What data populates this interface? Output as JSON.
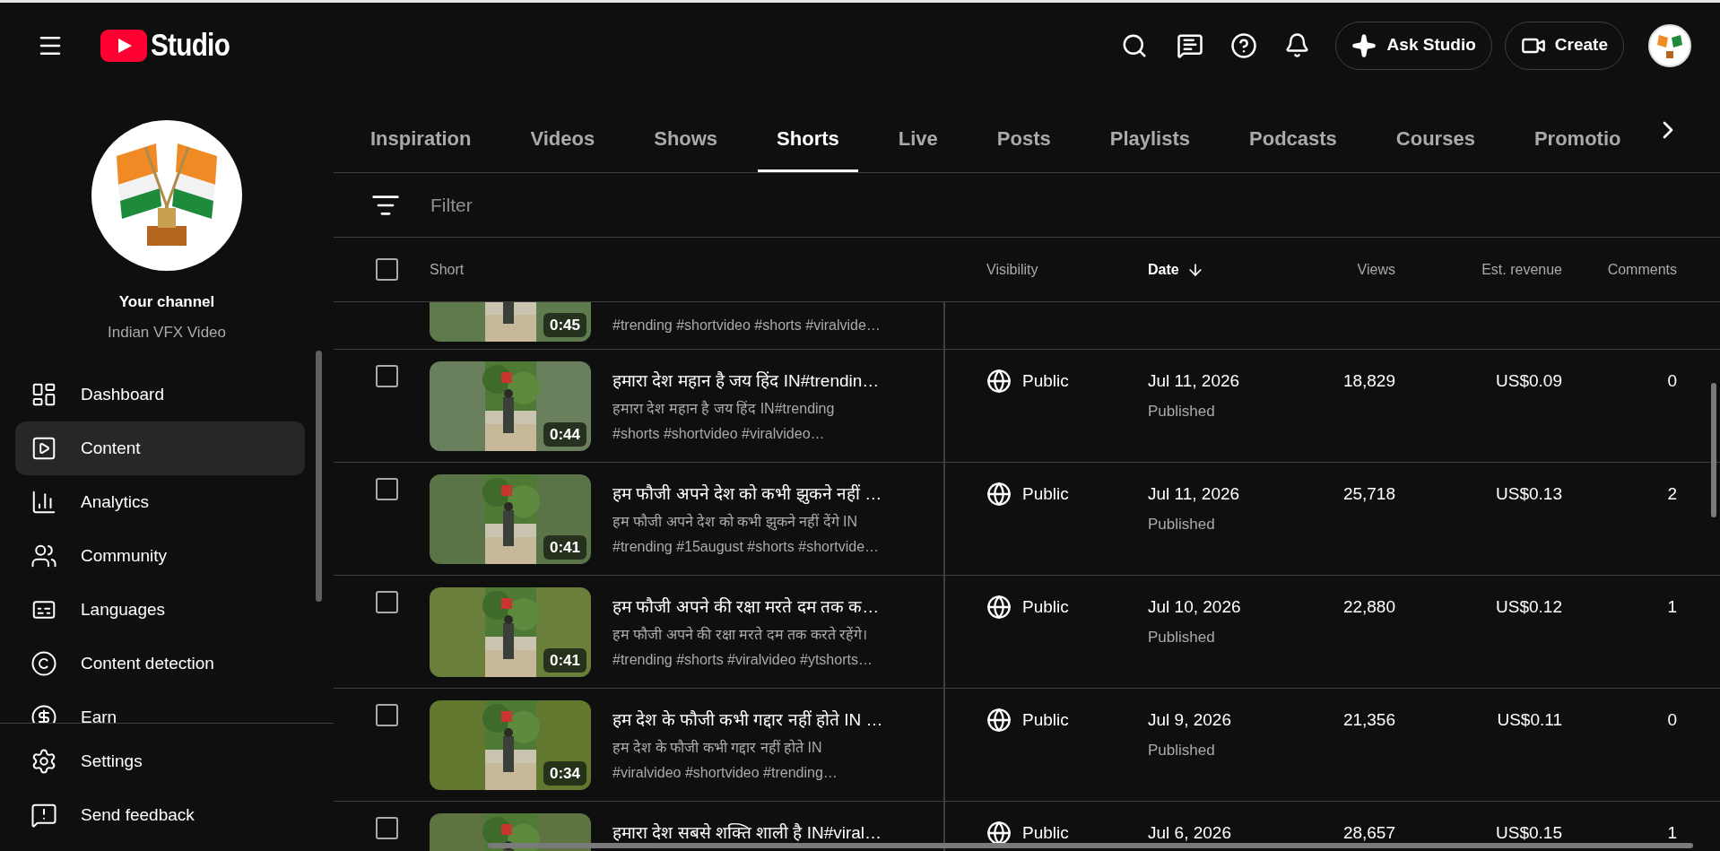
{
  "header": {
    "logo_text": "Studio",
    "ask_button": "Ask Studio",
    "create_button": "Create"
  },
  "sidebar": {
    "channel_label": "Your channel",
    "channel_name": "Indian VFX Video",
    "items": [
      {
        "kind": "dashboard",
        "label": "Dashboard",
        "selected": false
      },
      {
        "kind": "content",
        "label": "Content",
        "selected": true
      },
      {
        "kind": "analytics",
        "label": "Analytics",
        "selected": false
      },
      {
        "kind": "community",
        "label": "Community",
        "selected": false
      },
      {
        "kind": "languages",
        "label": "Languages",
        "selected": false
      },
      {
        "kind": "detection",
        "label": "Content detection",
        "selected": false
      },
      {
        "kind": "earn",
        "label": "Earn",
        "selected": false
      }
    ],
    "footer_items": [
      {
        "kind": "settings",
        "label": "Settings"
      },
      {
        "kind": "feedback",
        "label": "Send feedback"
      }
    ]
  },
  "tabs": [
    {
      "label": "Inspiration",
      "selected": false
    },
    {
      "label": "Videos",
      "selected": false
    },
    {
      "label": "Shows",
      "selected": false
    },
    {
      "label": "Shorts",
      "selected": true
    },
    {
      "label": "Live",
      "selected": false
    },
    {
      "label": "Posts",
      "selected": false
    },
    {
      "label": "Playlists",
      "selected": false
    },
    {
      "label": "Podcasts",
      "selected": false
    },
    {
      "label": "Courses",
      "selected": false
    },
    {
      "label": "Promotio",
      "selected": false
    }
  ],
  "filter": {
    "placeholder": "Filter"
  },
  "table": {
    "select_all_checked": false,
    "columns": [
      {
        "label": "Short",
        "sorted": false
      },
      {
        "label": "Visibility",
        "sorted": false
      },
      {
        "label": "Date",
        "sorted": true
      },
      {
        "label": "Views",
        "sorted": false
      },
      {
        "label": "Est. revenue",
        "sorted": false
      },
      {
        "label": "Comments",
        "sorted": false
      }
    ],
    "rows": [
      {
        "kind": "partial_top",
        "duration": "0:45",
        "description": [
          "#trending #shortvideo #shorts #viralvide…"
        ]
      },
      {
        "kind": "full",
        "checked": false,
        "duration": "0:44",
        "title": "हमारा देश महान है जय हिंद IN#trendin…",
        "description": [
          "हमारा देश महान है जय हिंद IN#trending",
          "#shorts #shortvideo #viralvideo…"
        ],
        "visibility": "Public",
        "date": "Jul 11, 2026",
        "status": "Published",
        "views": "18,829",
        "revenue": "US$0.09",
        "comments": "0"
      },
      {
        "kind": "full",
        "checked": false,
        "duration": "0:41",
        "title": "हम फौजी अपने देश को कभी झुकने नहीं …",
        "description": [
          "हम फौजी अपने देश को कभी झुकने नहीं देंगे IN",
          "#trending #15august #shorts #shortvide…"
        ],
        "visibility": "Public",
        "date": "Jul 11, 2026",
        "status": "Published",
        "views": "25,718",
        "revenue": "US$0.13",
        "comments": "2"
      },
      {
        "kind": "full",
        "checked": false,
        "duration": "0:41",
        "title": "हम फौजी अपने की रक्षा मरते दम तक क…",
        "description": [
          "हम फौजी अपने की रक्षा मरते दम तक करते रहेंगे।",
          "#trending #shorts #viralvideo #ytshorts…"
        ],
        "visibility": "Public",
        "date": "Jul 10, 2026",
        "status": "Published",
        "views": "22,880",
        "revenue": "US$0.12",
        "comments": "1"
      },
      {
        "kind": "full",
        "checked": false,
        "duration": "0:34",
        "title": "हम देश के फौजी कभी गद्दार नहीं होते IN …",
        "description": [
          "हम देश के फौजी कभी गद्दार नहीं होते IN",
          "#viralvideo #shortvideo #trending…"
        ],
        "visibility": "Public",
        "date": "Jul 9, 2026",
        "status": "Published",
        "views": "21,356",
        "revenue": "US$0.11",
        "comments": "0"
      },
      {
        "kind": "partial_bottom",
        "checked": false,
        "title": "हमारा देश सबसे शक्ति शाली है IN#viral…",
        "visibility": "Public",
        "date": "Jul 6, 2026",
        "views": "28,657",
        "revenue": "US$0.15",
        "comments": "1"
      }
    ]
  }
}
